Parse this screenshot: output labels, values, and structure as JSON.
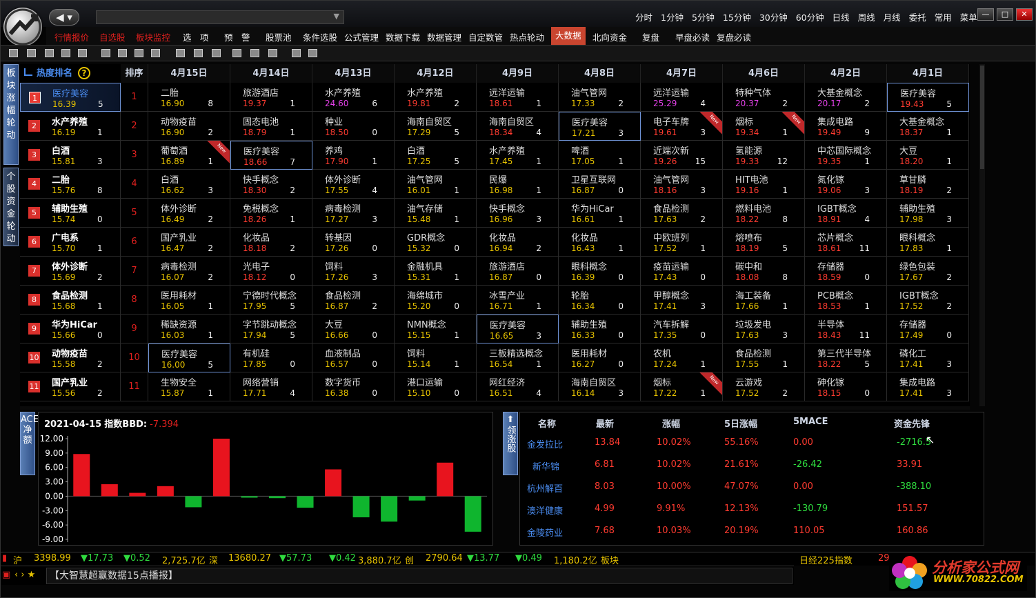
{
  "titlebar": {
    "nav": "◀ ▾",
    "periods": [
      "分时",
      "1分钟",
      "5分钟",
      "15分钟",
      "30分钟",
      "60分钟",
      "日线",
      "周线",
      "月线",
      "委托",
      "常用",
      "菜单"
    ],
    "controls": [
      "—",
      "□",
      "✕"
    ]
  },
  "menu": [
    {
      "label": "行情报价",
      "style": "red"
    },
    {
      "label": "自选股",
      "style": "red"
    },
    {
      "label": "板块监控",
      "style": "red"
    },
    {
      "label": "选　项",
      "style": "white"
    },
    {
      "label": "预　警",
      "style": "white"
    },
    {
      "label": "股票池",
      "style": "white"
    },
    {
      "label": "条件选股",
      "style": "white"
    },
    {
      "label": "公式管理",
      "style": "white"
    },
    {
      "label": "数据下载",
      "style": "white"
    },
    {
      "label": "数据管理",
      "style": "white"
    },
    {
      "label": "自定数管",
      "style": "white"
    },
    {
      "label": "热点轮动",
      "style": "white"
    },
    {
      "label": "大数据",
      "style": "active"
    },
    {
      "label": "北向资金",
      "style": "white"
    },
    {
      "label": "复盘",
      "style": "white"
    },
    {
      "label": "早盘必读",
      "style": "white"
    },
    {
      "label": "复盘必读",
      "style": "white"
    }
  ],
  "left_tabs": [
    "板块涨幅轮动",
    "个股资金轮动"
  ],
  "heat_table": {
    "title": "热度排名",
    "help": "?",
    "order_header": "排序",
    "dates": [
      "4月15日",
      "4月14日",
      "4月13日",
      "4月12日",
      "4月9日",
      "4月8日",
      "4月7日",
      "4月6日",
      "4月2日",
      "4月1日"
    ],
    "ranking": [
      {
        "rank": "1",
        "name": "医疗美容",
        "value": "16.39",
        "count": "5"
      },
      {
        "rank": "2",
        "name": "水产养殖",
        "value": "16.19",
        "count": "1"
      },
      {
        "rank": "3",
        "name": "白酒",
        "value": "15.81",
        "count": "3"
      },
      {
        "rank": "4",
        "name": "二胎",
        "value": "15.76",
        "count": "8"
      },
      {
        "rank": "5",
        "name": "辅助生殖",
        "value": "15.74",
        "count": "0"
      },
      {
        "rank": "6",
        "name": "广电系",
        "value": "15.70",
        "count": "1"
      },
      {
        "rank": "7",
        "name": "体外诊断",
        "value": "15.69",
        "count": "2"
      },
      {
        "rank": "8",
        "name": "食品检测",
        "value": "15.68",
        "count": "1"
      },
      {
        "rank": "9",
        "name": "华为HiCar",
        "value": "15.66",
        "count": "0"
      },
      {
        "rank": "10",
        "name": "动物疫苗",
        "value": "15.58",
        "count": "2"
      },
      {
        "rank": "11",
        "name": "国产乳业",
        "value": "15.56",
        "count": "2"
      }
    ],
    "order": [
      "1",
      "2",
      "3",
      "4",
      "5",
      "6",
      "7",
      "8",
      "9",
      "10",
      "11"
    ],
    "grid": [
      [
        {
          "n": "二胎",
          "v": "16.90",
          "c": "8",
          "k": "y"
        },
        {
          "n": "旅游酒店",
          "v": "19.37",
          "c": "1",
          "k": "r"
        },
        {
          "n": "水产养殖",
          "v": "24.60",
          "c": "6",
          "k": "m"
        },
        {
          "n": "水产养殖",
          "v": "19.81",
          "c": "2",
          "k": "r"
        },
        {
          "n": "远洋运输",
          "v": "18.61",
          "c": "1",
          "k": "r"
        },
        {
          "n": "油气管网",
          "v": "17.33",
          "c": "2",
          "k": "y"
        },
        {
          "n": "远洋运输",
          "v": "25.29",
          "c": "4",
          "k": "m"
        },
        {
          "n": "特种气体",
          "v": "20.37",
          "c": "2",
          "k": "m"
        },
        {
          "n": "大基金概念",
          "v": "20.17",
          "c": "2",
          "k": "m"
        },
        {
          "n": "医疗美容",
          "v": "19.43",
          "c": "5",
          "k": "r",
          "sel": true
        }
      ],
      [
        {
          "n": "动物疫苗",
          "v": "16.90",
          "c": "2",
          "k": "y"
        },
        {
          "n": "固态电池",
          "v": "18.79",
          "c": "1",
          "k": "r"
        },
        {
          "n": "种业",
          "v": "18.50",
          "c": "0",
          "k": "r"
        },
        {
          "n": "海南自贸区",
          "v": "17.29",
          "c": "5",
          "k": "y"
        },
        {
          "n": "海南自贸区",
          "v": "18.34",
          "c": "4",
          "k": "r"
        },
        {
          "n": "医疗美容",
          "v": "17.21",
          "c": "3",
          "k": "y",
          "sel": true
        },
        {
          "n": "电子车牌",
          "v": "19.61",
          "c": "3",
          "k": "r",
          "newtag": true
        },
        {
          "n": "烟标",
          "v": "19.34",
          "c": "1",
          "k": "r",
          "newtag": true
        },
        {
          "n": "集成电路",
          "v": "19.49",
          "c": "9",
          "k": "r"
        },
        {
          "n": "大基金概念",
          "v": "18.37",
          "c": "1",
          "k": "r"
        }
      ],
      [
        {
          "n": "葡萄酒",
          "v": "16.89",
          "c": "1",
          "k": "y",
          "newtag": true
        },
        {
          "n": "医疗美容",
          "v": "18.66",
          "c": "7",
          "k": "r",
          "sel": true
        },
        {
          "n": "养鸡",
          "v": "17.90",
          "c": "1",
          "k": "r"
        },
        {
          "n": "白酒",
          "v": "17.25",
          "c": "5",
          "k": "y"
        },
        {
          "n": "水产养殖",
          "v": "17.45",
          "c": "1",
          "k": "y"
        },
        {
          "n": "啤酒",
          "v": "17.05",
          "c": "1",
          "k": "y"
        },
        {
          "n": "近端次新",
          "v": "19.26",
          "c": "15",
          "k": "r"
        },
        {
          "n": "氢能源",
          "v": "19.33",
          "c": "12",
          "k": "r"
        },
        {
          "n": "中芯国际概念",
          "v": "19.35",
          "c": "1",
          "k": "r"
        },
        {
          "n": "大豆",
          "v": "18.20",
          "c": "1",
          "k": "r"
        }
      ],
      [
        {
          "n": "白酒",
          "v": "16.62",
          "c": "3",
          "k": "y"
        },
        {
          "n": "快手概念",
          "v": "18.30",
          "c": "2",
          "k": "r"
        },
        {
          "n": "体外诊断",
          "v": "17.55",
          "c": "4",
          "k": "y"
        },
        {
          "n": "油气管网",
          "v": "16.01",
          "c": "1",
          "k": "y"
        },
        {
          "n": "民爆",
          "v": "16.98",
          "c": "1",
          "k": "y"
        },
        {
          "n": "卫星互联网",
          "v": "16.87",
          "c": "0",
          "k": "y"
        },
        {
          "n": "油气管网",
          "v": "18.16",
          "c": "3",
          "k": "r"
        },
        {
          "n": "HIT电池",
          "v": "19.16",
          "c": "1",
          "k": "r"
        },
        {
          "n": "氮化镓",
          "v": "19.06",
          "c": "3",
          "k": "r"
        },
        {
          "n": "草甘膦",
          "v": "18.19",
          "c": "2",
          "k": "r"
        }
      ],
      [
        {
          "n": "体外诊断",
          "v": "16.49",
          "c": "2",
          "k": "y"
        },
        {
          "n": "免税概念",
          "v": "18.26",
          "c": "1",
          "k": "r"
        },
        {
          "n": "病毒检测",
          "v": "17.27",
          "c": "3",
          "k": "y"
        },
        {
          "n": "油气存储",
          "v": "15.48",
          "c": "1",
          "k": "y"
        },
        {
          "n": "快手概念",
          "v": "16.96",
          "c": "3",
          "k": "y"
        },
        {
          "n": "华为HiCar",
          "v": "16.61",
          "c": "1",
          "k": "y"
        },
        {
          "n": "食品检测",
          "v": "17.63",
          "c": "2",
          "k": "y"
        },
        {
          "n": "燃料电池",
          "v": "18.22",
          "c": "8",
          "k": "r"
        },
        {
          "n": "IGBT概念",
          "v": "18.91",
          "c": "4",
          "k": "r"
        },
        {
          "n": "辅助生殖",
          "v": "17.98",
          "c": "3",
          "k": "y"
        }
      ],
      [
        {
          "n": "国产乳业",
          "v": "16.47",
          "c": "2",
          "k": "y"
        },
        {
          "n": "化妆品",
          "v": "18.18",
          "c": "2",
          "k": "r"
        },
        {
          "n": "转基因",
          "v": "17.26",
          "c": "0",
          "k": "y"
        },
        {
          "n": "GDR概念",
          "v": "15.32",
          "c": "0",
          "k": "y"
        },
        {
          "n": "化妆品",
          "v": "16.94",
          "c": "2",
          "k": "y"
        },
        {
          "n": "化妆品",
          "v": "16.43",
          "c": "1",
          "k": "y"
        },
        {
          "n": "中欧班列",
          "v": "17.52",
          "c": "1",
          "k": "y"
        },
        {
          "n": "熔喷布",
          "v": "18.19",
          "c": "5",
          "k": "r"
        },
        {
          "n": "芯片概念",
          "v": "18.61",
          "c": "11",
          "k": "r"
        },
        {
          "n": "眼科概念",
          "v": "17.83",
          "c": "1",
          "k": "y"
        }
      ],
      [
        {
          "n": "病毒检测",
          "v": "16.07",
          "c": "2",
          "k": "y"
        },
        {
          "n": "光电子",
          "v": "18.12",
          "c": "0",
          "k": "r"
        },
        {
          "n": "饲料",
          "v": "17.26",
          "c": "3",
          "k": "y"
        },
        {
          "n": "金融机具",
          "v": "15.31",
          "c": "1",
          "k": "y"
        },
        {
          "n": "旅游酒店",
          "v": "16.87",
          "c": "0",
          "k": "y"
        },
        {
          "n": "眼科概念",
          "v": "16.39",
          "c": "0",
          "k": "y"
        },
        {
          "n": "疫苗运输",
          "v": "17.43",
          "c": "0",
          "k": "y"
        },
        {
          "n": "碳中和",
          "v": "18.08",
          "c": "8",
          "k": "r"
        },
        {
          "n": "存储器",
          "v": "18.59",
          "c": "0",
          "k": "r"
        },
        {
          "n": "绿色包装",
          "v": "17.67",
          "c": "2",
          "k": "y"
        }
      ],
      [
        {
          "n": "医用耗材",
          "v": "16.05",
          "c": "1",
          "k": "y"
        },
        {
          "n": "宁德时代概念",
          "v": "17.95",
          "c": "5",
          "k": "y"
        },
        {
          "n": "食品检测",
          "v": "16.87",
          "c": "2",
          "k": "y"
        },
        {
          "n": "海绵城市",
          "v": "15.20",
          "c": "0",
          "k": "y"
        },
        {
          "n": "冰雪产业",
          "v": "16.71",
          "c": "1",
          "k": "y"
        },
        {
          "n": "轮胎",
          "v": "16.34",
          "c": "0",
          "k": "y"
        },
        {
          "n": "甲醇概念",
          "v": "17.41",
          "c": "3",
          "k": "y"
        },
        {
          "n": "海工装备",
          "v": "17.66",
          "c": "1",
          "k": "y"
        },
        {
          "n": "PCB概念",
          "v": "18.53",
          "c": "1",
          "k": "r"
        },
        {
          "n": "IGBT概念",
          "v": "17.52",
          "c": "2",
          "k": "y"
        }
      ],
      [
        {
          "n": "稀缺资源",
          "v": "16.03",
          "c": "1",
          "k": "y"
        },
        {
          "n": "字节跳动概念",
          "v": "17.94",
          "c": "5",
          "k": "y"
        },
        {
          "n": "大豆",
          "v": "16.66",
          "c": "0",
          "k": "y"
        },
        {
          "n": "NMN概念",
          "v": "15.15",
          "c": "1",
          "k": "y"
        },
        {
          "n": "医疗美容",
          "v": "16.65",
          "c": "3",
          "k": "y",
          "sel": true
        },
        {
          "n": "辅助生殖",
          "v": "16.33",
          "c": "0",
          "k": "y"
        },
        {
          "n": "汽车拆解",
          "v": "17.35",
          "c": "0",
          "k": "y"
        },
        {
          "n": "垃圾发电",
          "v": "17.63",
          "c": "3",
          "k": "y"
        },
        {
          "n": "半导体",
          "v": "18.43",
          "c": "11",
          "k": "r"
        },
        {
          "n": "存储器",
          "v": "17.49",
          "c": "0",
          "k": "y"
        }
      ],
      [
        {
          "n": "医疗美容",
          "v": "16.00",
          "c": "5",
          "k": "y",
          "sel": true
        },
        {
          "n": "有机硅",
          "v": "17.85",
          "c": "0",
          "k": "y"
        },
        {
          "n": "血液制品",
          "v": "16.57",
          "c": "0",
          "k": "y"
        },
        {
          "n": "饲料",
          "v": "15.14",
          "c": "1",
          "k": "y"
        },
        {
          "n": "三板精选概念",
          "v": "16.54",
          "c": "1",
          "k": "y"
        },
        {
          "n": "医用耗材",
          "v": "16.27",
          "c": "0",
          "k": "y"
        },
        {
          "n": "农机",
          "v": "17.24",
          "c": "1",
          "k": "y"
        },
        {
          "n": "食品检测",
          "v": "17.55",
          "c": "1",
          "k": "y"
        },
        {
          "n": "第三代半导体",
          "v": "18.22",
          "c": "5",
          "k": "r"
        },
        {
          "n": "磷化工",
          "v": "17.41",
          "c": "3",
          "k": "y"
        }
      ],
      [
        {
          "n": "生物安全",
          "v": "15.87",
          "c": "1",
          "k": "y"
        },
        {
          "n": "网络营销",
          "v": "17.71",
          "c": "4",
          "k": "y"
        },
        {
          "n": "数字货币",
          "v": "16.38",
          "c": "0",
          "k": "y"
        },
        {
          "n": "港口运输",
          "v": "15.10",
          "c": "0",
          "k": "y"
        },
        {
          "n": "网红经济",
          "v": "16.51",
          "c": "4",
          "k": "y"
        },
        {
          "n": "海南自贸区",
          "v": "16.14",
          "c": "3",
          "k": "y"
        },
        {
          "n": "烟标",
          "v": "17.22",
          "c": "1",
          "k": "y",
          "newtag": true
        },
        {
          "n": "云游戏",
          "v": "17.52",
          "c": "2",
          "k": "y"
        },
        {
          "n": "砷化镓",
          "v": "18.15",
          "c": "0",
          "k": "r"
        },
        {
          "n": "集成电路",
          "v": "17.41",
          "c": "3",
          "k": "y"
        }
      ]
    ],
    "new_label": "New"
  },
  "bbd": {
    "tab": "ACE净额",
    "date": "2021-04-15",
    "name": "指数BBD:",
    "value": "-7.394"
  },
  "chart_data": {
    "type": "bar",
    "title": "2021-04-15 指数BBD: -7.394",
    "yticks": [
      "12.00",
      "9.00",
      "6.00",
      "3.00",
      "0.00",
      "-3.00",
      "-6.00",
      "-9.00"
    ],
    "ylim": [
      -9,
      12
    ],
    "values": [
      8.8,
      2.5,
      0.7,
      2.1,
      -2.3,
      12.0,
      -0.3,
      -0.4,
      -2.4,
      5.6,
      -4.4,
      -5.3,
      -0.9,
      7.0,
      -7.4
    ],
    "colors": {
      "up": "#e8141e",
      "down": "#0fb52e"
    }
  },
  "stocks": {
    "tab": "领涨股",
    "headers": [
      "名称",
      "最新",
      "涨幅",
      "5日涨幅",
      "5MACE",
      "资金先锋"
    ],
    "rows": [
      {
        "name": "金发拉比",
        "price": "13.84",
        "chg": "10.02%",
        "chg5": "55.16%",
        "mace": "0.00",
        "mace_c": "w",
        "fund": "-2716.5",
        "fund_c": "g"
      },
      {
        "name": "新华锦",
        "price": "6.81",
        "chg": "10.02%",
        "chg5": "21.61%",
        "mace": "-26.42",
        "mace_c": "g",
        "fund": "33.91",
        "fund_c": "r"
      },
      {
        "name": "杭州解百",
        "price": "8.03",
        "chg": "10.00%",
        "chg5": "47.07%",
        "mace": "0.00",
        "mace_c": "w",
        "fund": "-388.10",
        "fund_c": "g"
      },
      {
        "name": "澳洋健康",
        "price": "4.99",
        "chg": "9.91%",
        "chg5": "12.13%",
        "mace": "-130.79",
        "mace_c": "g",
        "fund": "151.57",
        "fund_c": "r"
      },
      {
        "name": "金陵药业",
        "price": "7.68",
        "chg": "10.03%",
        "chg5": "20.19%",
        "mace": "110.05",
        "mace_c": "r",
        "fund": "160.86",
        "fund_c": "r"
      }
    ]
  },
  "statusbar": {
    "sh": {
      "label": "沪",
      "idx": "3398.99",
      "chg": "▼17.73",
      "pct": "▼0.52",
      "amt": "2,725.7亿"
    },
    "sz": {
      "label": "深",
      "idx": "13680.27",
      "chg": "▼57.73",
      "pct": "▼0.42",
      "amt": "3,880.7亿"
    },
    "cy": {
      "label": "创",
      "idx": "2790.64",
      "chg": "▼13.77",
      "pct": "▼0.49",
      "amt": "1,180.2亿"
    },
    "bk": "板块",
    "nikkei": "日经225指数",
    "nikkei_val": "29"
  },
  "news": {
    "text": "【大智慧超赢数据15点播报】",
    "nav": "‹ › ★"
  },
  "watermark": {
    "title": "分析家公式网",
    "url": "WWW.70822.COM"
  }
}
